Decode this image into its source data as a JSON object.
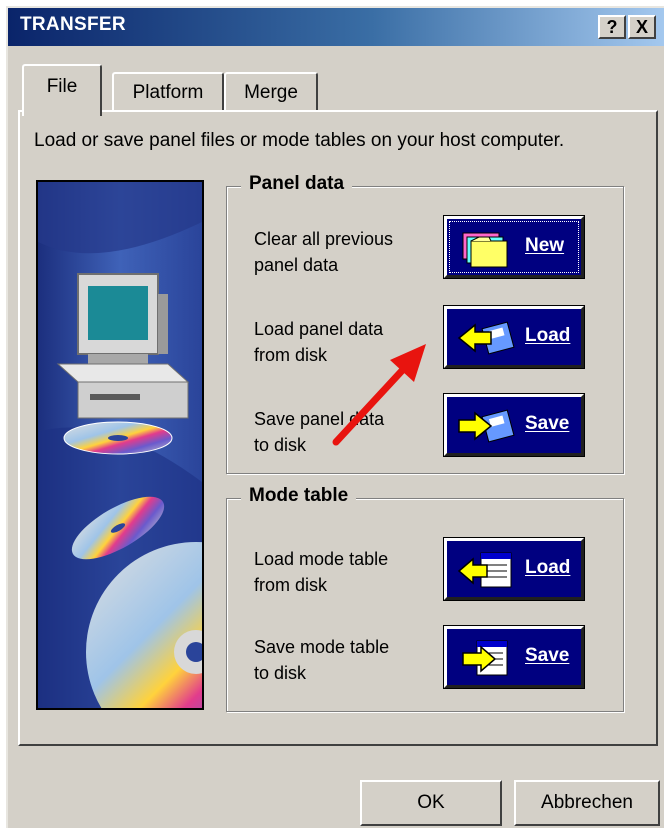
{
  "window": {
    "title": "TRANSFER",
    "help_label": "?",
    "close_label": "X"
  },
  "tabs": [
    {
      "label": "File",
      "active": true
    },
    {
      "label": "Platform",
      "active": false
    },
    {
      "label": "Merge",
      "active": false
    }
  ],
  "description": "Load or save panel files or mode tables on your host computer.",
  "panel_data": {
    "title": "Panel data",
    "rows": [
      {
        "label_line1": "Clear all previous",
        "label_line2": "panel data",
        "button": "New",
        "icon": "new-folders-icon"
      },
      {
        "label_line1": "Load panel data",
        "label_line2": "from disk",
        "button": "Load",
        "icon": "load-disk-icon"
      },
      {
        "label_line1": "Save panel data",
        "label_line2": "to disk",
        "button": "Save",
        "icon": "save-disk-icon"
      }
    ]
  },
  "mode_table": {
    "title": "Mode table",
    "rows": [
      {
        "label_line1": "Load mode table",
        "label_line2": "from disk",
        "button": "Load",
        "icon": "load-table-icon"
      },
      {
        "label_line1": "Save mode table",
        "label_line2": "to disk",
        "button": "Save",
        "icon": "save-table-icon"
      }
    ]
  },
  "footer": {
    "ok_label": "OK",
    "cancel_label": "Abbrechen"
  },
  "colors": {
    "button_bg": "#000080",
    "arrow": "#e8140f",
    "titlebar": "#0a246a",
    "face": "#d4d0c8"
  }
}
